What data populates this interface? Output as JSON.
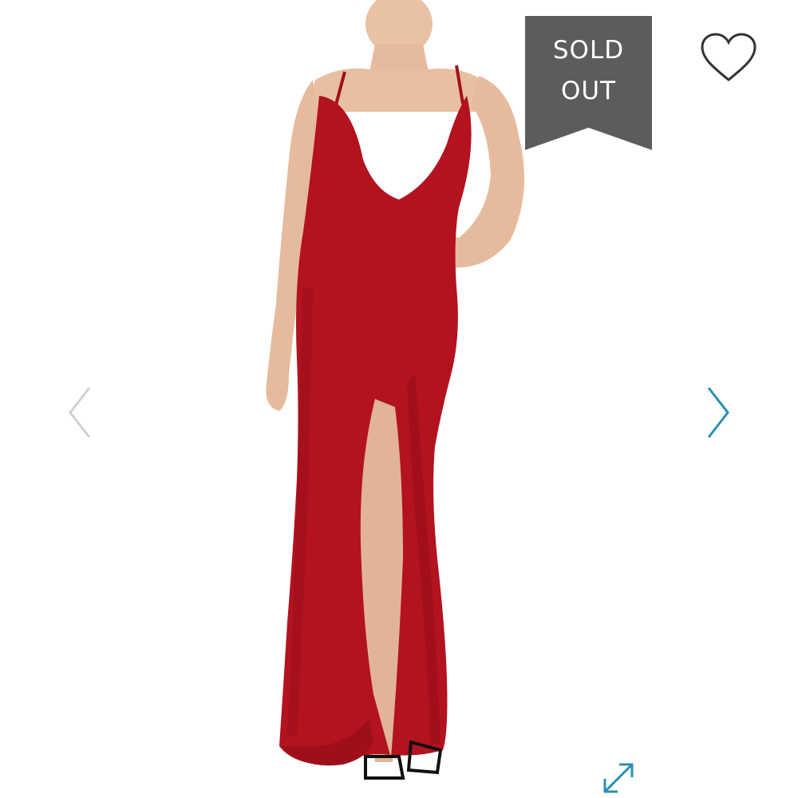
{
  "badge": {
    "line1": "SOLD",
    "line2": "OUT",
    "color": "#5c5c5c"
  },
  "product": {
    "dress_color": "#b3121f",
    "icon": "product-photo-red-gown"
  },
  "icons": {
    "favorite": "heart-outline-icon",
    "previous": "chevron-left-icon",
    "next": "chevron-right-icon",
    "expand": "expand-arrows-icon"
  },
  "colors": {
    "accent": "#2a8fb0",
    "disabled_arrow": "#d0d0d0",
    "heart_stroke": "#333333"
  }
}
